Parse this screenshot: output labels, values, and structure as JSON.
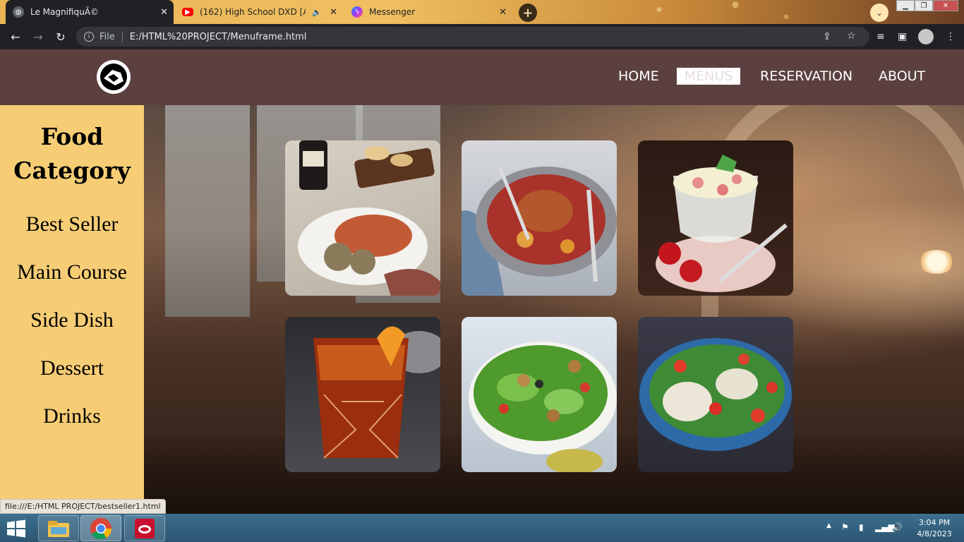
{
  "browser": {
    "tabs": [
      {
        "title": "Le MagnifiquÃ©",
        "icon": "globe-icon",
        "active": true
      },
      {
        "title": "(162) High School DXD [AMV",
        "icon": "youtube-icon",
        "active": false
      },
      {
        "title": "Messenger",
        "icon": "messenger-icon",
        "active": false
      }
    ],
    "new_tab": "+",
    "address": {
      "scheme": "File",
      "url": "E:/HTML%20PROJECT/Menuframe.html"
    }
  },
  "site": {
    "nav": {
      "items": [
        "HOME",
        "MENUS",
        "RESERVATION",
        "ABOUT"
      ],
      "active": "MENUS"
    },
    "sidebar": {
      "title_line1": "Food",
      "title_line2": "Category",
      "categories": [
        "Best Seller",
        "Main Course",
        "Side Dish",
        "Dessert",
        "Drinks"
      ]
    },
    "gallery": [
      {
        "name": "pasta-dish-photo"
      },
      {
        "name": "chicken-stew-photo"
      },
      {
        "name": "strawberry-dessert-photo"
      },
      {
        "name": "negroni-drink-photo"
      },
      {
        "name": "caesar-salad-photo"
      },
      {
        "name": "bean-salad-photo"
      }
    ]
  },
  "status_link": "file:///E:/HTML PROJECT/bestseller1.html",
  "taskbar": {
    "time": "3:04 PM",
    "date": "4/8/2023"
  },
  "colors": {
    "nav_bg": "#5c4040",
    "sidebar_bg": "#f6cd75"
  }
}
